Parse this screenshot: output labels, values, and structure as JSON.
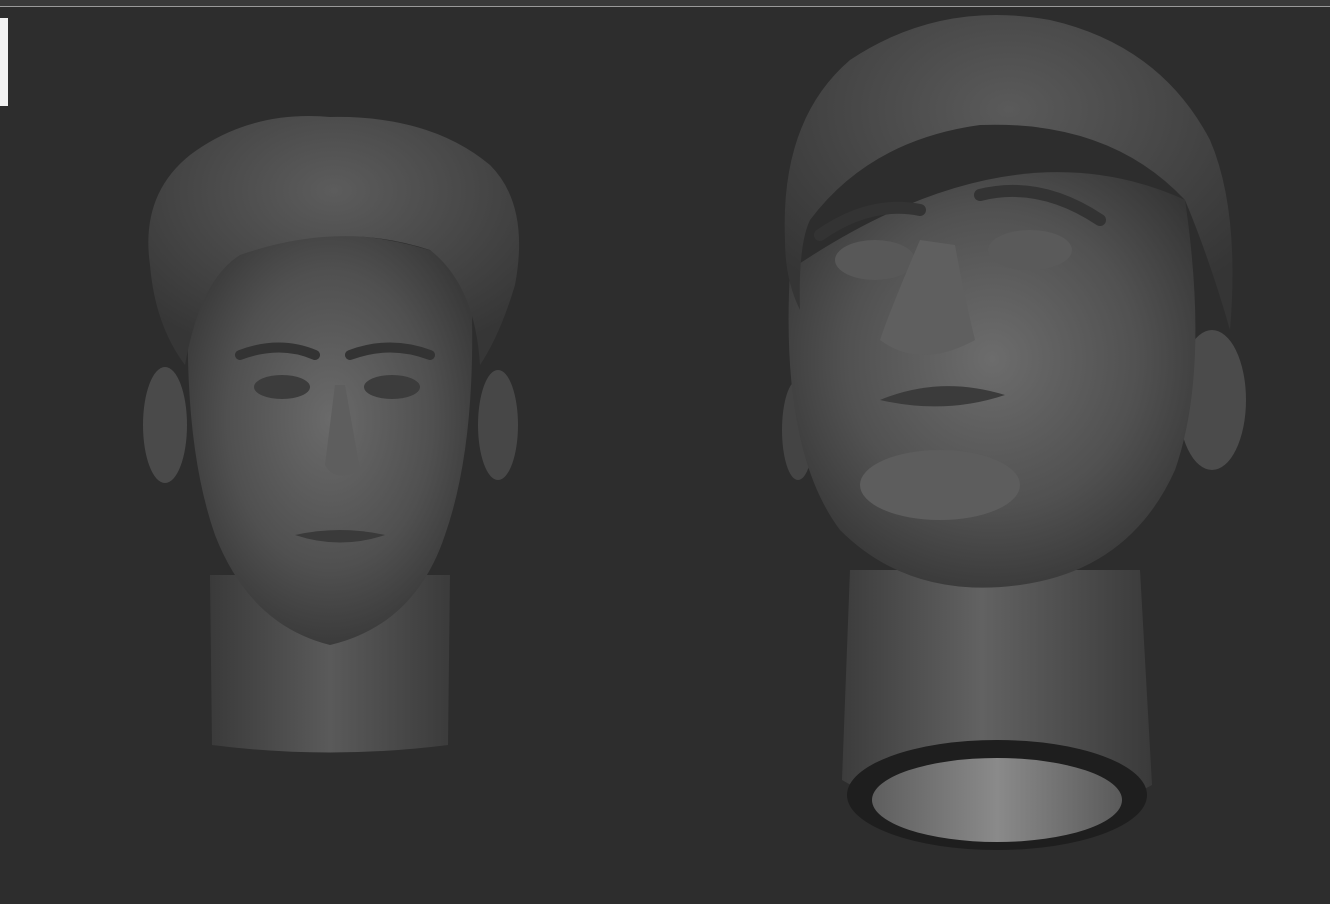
{
  "scene": {
    "background_color": "#2d2d2d",
    "models": [
      {
        "icon": "sculpted-head-front-icon",
        "view": "front"
      },
      {
        "icon": "sculpted-head-upward-icon",
        "view": "three-quarter-up"
      }
    ]
  }
}
